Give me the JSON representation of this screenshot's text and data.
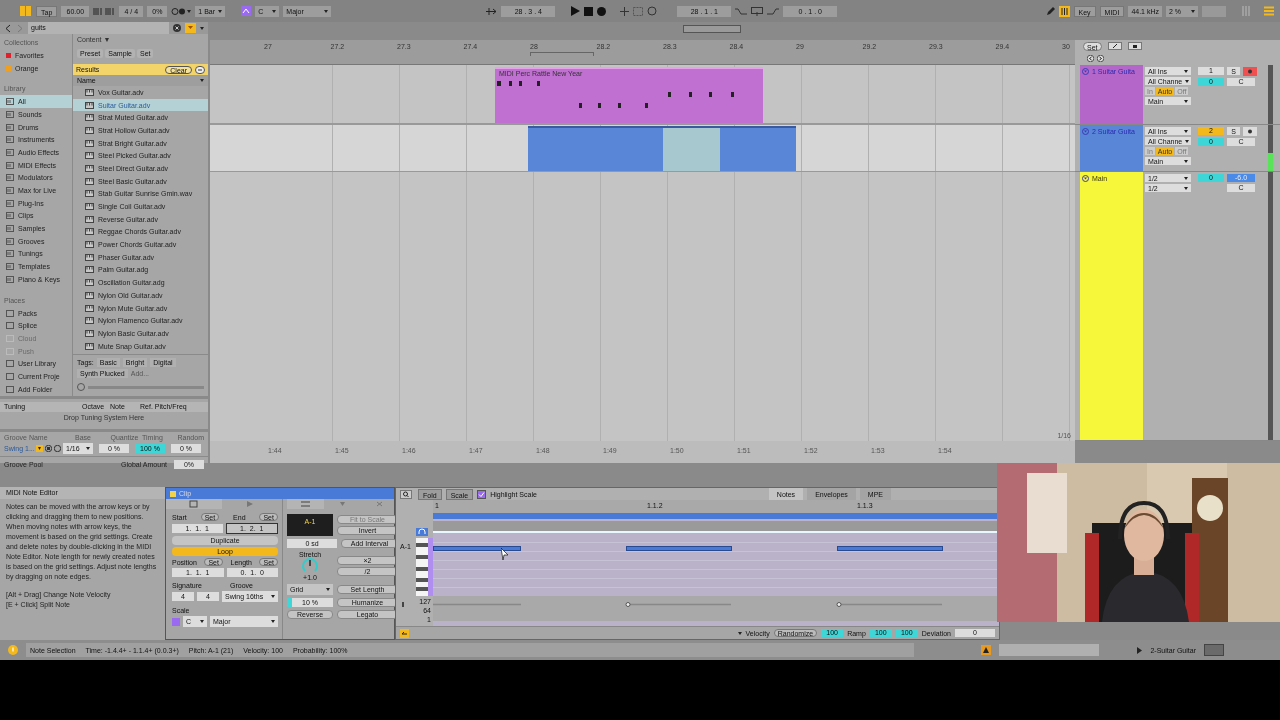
{
  "transport": {
    "tap": "Tap",
    "tempo": "60.00",
    "signature": "4 / 4",
    "groove": "0%",
    "quantize": "1 Bar",
    "key": "C",
    "scale": "Major",
    "position": "28 . 3 . 4",
    "loop_start": "28 . 1 . 1",
    "loop_length": "0 . 1 . 0",
    "key_map": "Key",
    "midi_map": "MIDI",
    "sample_rate": "44.1 kHz",
    "cpu": "2 %"
  },
  "browser": {
    "search": "guits",
    "collections_title": "Collections",
    "collections": [
      {
        "label": "Favorites",
        "color": "#e0202a"
      },
      {
        "label": "Orange",
        "color": "#f0a020"
      }
    ],
    "library_title": "Library",
    "library": [
      {
        "label": "All",
        "selected": true
      },
      {
        "label": "Sounds",
        "selected": false
      },
      {
        "label": "Drums",
        "selected": false
      },
      {
        "label": "Instruments",
        "selected": false
      },
      {
        "label": "Audio Effects",
        "selected": false
      },
      {
        "label": "MIDI Effects",
        "selected": false
      },
      {
        "label": "Modulators",
        "selected": false
      },
      {
        "label": "Max for Live",
        "selected": false
      },
      {
        "label": "Plug-Ins",
        "selected": false
      },
      {
        "label": "Clips",
        "selected": false
      },
      {
        "label": "Samples",
        "selected": false
      },
      {
        "label": "Grooves",
        "selected": false
      },
      {
        "label": "Tunings",
        "selected": false
      },
      {
        "label": "Templates",
        "selected": false
      },
      {
        "label": "Piano & Keys",
        "selected": false
      }
    ],
    "places_title": "Places",
    "places": [
      {
        "label": "Packs",
        "disabled": false
      },
      {
        "label": "Splice",
        "disabled": false
      },
      {
        "label": "Cloud",
        "disabled": true
      },
      {
        "label": "Push",
        "disabled": true
      },
      {
        "label": "User Library",
        "disabled": false
      },
      {
        "label": "Current Proje",
        "disabled": false
      },
      {
        "label": "Add Folder",
        "disabled": false
      }
    ],
    "content_label": "Content ▼",
    "filters": [
      "Preset",
      "Sample",
      "Set"
    ],
    "results": "Results",
    "clear": "Clear",
    "column": "Name",
    "files": [
      {
        "name": "Vox Guitar.adv",
        "selected": false
      },
      {
        "name": "Suitar Guitar.adv",
        "selected": true
      },
      {
        "name": "Strat Muted Guitar.adv",
        "selected": false
      },
      {
        "name": "Strat Hollow Guitar.adv",
        "selected": false
      },
      {
        "name": "Strat Bright Guitar.adv",
        "selected": false
      },
      {
        "name": "Steel Picked Guitar.adv",
        "selected": false
      },
      {
        "name": "Steel Direct Guitar.adv",
        "selected": false
      },
      {
        "name": "Steel Basic Guitar.adv",
        "selected": false
      },
      {
        "name": "Stab Guitar Sunrise Gmin.wav",
        "selected": false
      },
      {
        "name": "Single Coil Guitar.adv",
        "selected": false
      },
      {
        "name": "Reverse Guitar.adv",
        "selected": false
      },
      {
        "name": "Reggae Chords Guitar.adv",
        "selected": false
      },
      {
        "name": "Power Chords Guitar.adv",
        "selected": false
      },
      {
        "name": "Phaser Guitar.adv",
        "selected": false
      },
      {
        "name": "Palm Guitar.adg",
        "selected": false
      },
      {
        "name": "Oscillation Guitar.adg",
        "selected": false
      },
      {
        "name": "Nylon Old Guitar.adv",
        "selected": false
      },
      {
        "name": "Nylon Mute Guitar.adv",
        "selected": false
      },
      {
        "name": "Nylon Flamenco Guitar.adv",
        "selected": false
      },
      {
        "name": "Nylon Basic Guitar.adv",
        "selected": false
      },
      {
        "name": "Mute Snap Guitar.adv",
        "selected": false
      }
    ],
    "tags_label": "Tags:",
    "tags": [
      "Basic",
      "Bright",
      "Digital",
      "Synth Plucked"
    ],
    "tag_placeholder": "Add..."
  },
  "tuning": {
    "headers": [
      "Tuning",
      "Octave",
      "Note",
      "Ref. Pitch/Freq"
    ],
    "drop": "Drop Tuning System Here"
  },
  "groove": {
    "headers": [
      "Groove Name",
      "Base",
      "Quantize",
      "Timing",
      "Random"
    ],
    "name": "Swing 1...",
    "base": "1/16",
    "quantize": "0 %",
    "timing": "100 %",
    "random": "0 %",
    "pool": "Groove Pool",
    "global_label": "Global Amount",
    "global": "0%"
  },
  "arrangement": {
    "ruler": [
      "27",
      "27.2",
      "27.3",
      "27.4",
      "28",
      "28.2",
      "28.3",
      "28.4",
      "29",
      "29.2",
      "29.3",
      "29.4",
      "30"
    ],
    "times": [
      "1:44",
      "1:45",
      "1:46",
      "1:47",
      "1:48",
      "1:49",
      "1:50",
      "1:51",
      "1:52",
      "1:53",
      "1:54"
    ],
    "clips": [
      {
        "kind": "midi",
        "title": "MIDI Perc Rattle New Year",
        "color": "#c070d0"
      },
      {
        "kind": "audio",
        "color": "#5a86d8"
      }
    ],
    "grid_label": "1/16"
  },
  "tracks": {
    "set": "Set",
    "items": [
      {
        "kind": "track",
        "name": "1 Suitar Guita",
        "color": "#b566c9",
        "input": "All Ins",
        "channel": "All Channe",
        "monitor": [
          {
            "label": "In",
            "selected": false
          },
          {
            "label": "Auto",
            "selected": true
          },
          {
            "label": "Off",
            "selected": false
          }
        ],
        "output": "Main",
        "number": "1",
        "selected": false,
        "volume": "0",
        "pan": "C",
        "solo": "S",
        "armed": true
      },
      {
        "kind": "track",
        "name": "2 Suitar Guita",
        "color": "#5a86d8",
        "input": "All Ins",
        "channel": "All Channe",
        "monitor": [
          {
            "label": "In",
            "selected": false
          },
          {
            "label": "Auto",
            "selected": true
          },
          {
            "label": "Off",
            "selected": false
          }
        ],
        "output": "Main",
        "number": "2",
        "selected": true,
        "volume": "0",
        "pan": "C",
        "solo": "S",
        "armed": false
      },
      {
        "kind": "main",
        "name": "Main",
        "color": "#f6f63a",
        "input": "1/2",
        "output": "1/2",
        "volume": "0",
        "gain": "-6.0",
        "pan": "C"
      }
    ]
  },
  "info": {
    "title": "MIDI Note Editor",
    "body": "Notes can be moved with the arrow keys or by clicking and dragging them to new positions. When moving notes with arrow keys, the movement is based on the grid settings. Create and delete notes by double-clicking in the MIDI Note Editor. Note length for newly created notes is based on the grid settings. Adjust note lengths by dragging on note edges.",
    "shortcuts": [
      "[Alt + Drag] Change Note Velocity",
      "[E + Click] Split Note"
    ]
  },
  "clip": {
    "title": "Clip",
    "start_label": "Start",
    "start_set": "Set",
    "end_label": "End",
    "end_set": "Set",
    "start": "1.  1.  1",
    "end": "1.  2.  1",
    "duplicate": "Duplicate",
    "loop": "Loop",
    "loop_on": true,
    "position_label": "Position",
    "position_set": "Set",
    "length_label": "Length",
    "length_set": "Set",
    "position": "1.  1.  1",
    "length": "0.  1.  0",
    "signature_label": "Signature",
    "groove_label": "Groove",
    "signature": [
      "4",
      "4"
    ],
    "groove": "Swing 16ths",
    "scale_label": "Scale",
    "scale_key": "C",
    "scale_name": "Major"
  },
  "note_tools": {
    "pitch": "A-1",
    "fit": "Fit to Scale",
    "invert": "Invert",
    "interval": "0 sd",
    "add_interval": "Add Interval",
    "stretch_label": "Stretch",
    "stretch": "+1.0",
    "double": "×2",
    "half": "/2",
    "grid": "Grid",
    "set_length": "Set Length",
    "humanize_amount": "10 %",
    "level": 0.1,
    "humanize": "Humanize",
    "reverse": "Reverse",
    "legato": "Legato"
  },
  "editor": {
    "fold": "Fold",
    "scale": "Scale",
    "highlight": {
      "label": "Highlight Scale",
      "checked": true
    },
    "tabs": [
      {
        "label": "Notes",
        "selected": true
      },
      {
        "label": "Envelopes",
        "selected": false
      },
      {
        "label": "MPE",
        "selected": false
      }
    ],
    "ruler": [
      "1",
      "1.1.2",
      "1.1.3"
    ],
    "pitch": "A-1",
    "velocity_ticks": [
      "127",
      "64",
      "1"
    ],
    "velocity_label": "Velocity",
    "randomize": "Randomize",
    "velocity": "100",
    "ramp_label": "Ramp",
    "ramp": [
      "100",
      "100"
    ],
    "deviation_label": "Deviation",
    "deviation": "0"
  },
  "status": {
    "mode": "Note Selection",
    "time": "Time: -1.4.4+ - 1.1.4+ (0.0.3+)",
    "pitch": "Pitch: A-1 (21)",
    "velocity": "Velocity: 100",
    "probability": "Probability: 100%",
    "track": "2-Suitar Guitar"
  }
}
